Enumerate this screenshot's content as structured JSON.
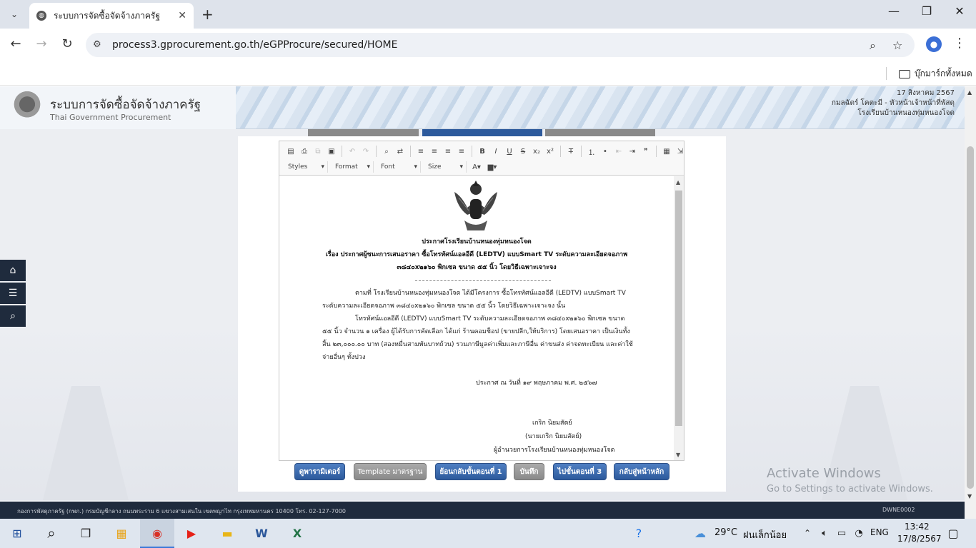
{
  "browser": {
    "tab_title": "ระบบการจัดซื้อจัดจ้างภาครัฐ",
    "url": "process3.gprocurement.go.th/eGPProcure/secured/HOME",
    "bookmarks_folder": "บุ๊กมาร์กทั้งหมด"
  },
  "header": {
    "site_name": "ระบบการจัดซื้อจัดจ้างภาครัฐ",
    "site_name_en": "Thai Government Procurement",
    "date": "17 สิงหาคม 2567",
    "user": "กมลฉัตร์ โคตะมี - หัวหน้าเจ้าหน้าที่พัสดุ",
    "org": "โรงเรียนบ้านหนองทุ่มหนองโจด"
  },
  "editor": {
    "combo_styles": "Styles",
    "combo_format": "Format",
    "combo_font": "Font",
    "combo_size": "Size"
  },
  "document": {
    "title": "ประกาศโรงเรียนบ้านหนองทุ่มหนองโจด",
    "subject1": "เรื่อง ประกาศผู้ชนะการเสนอราคา ซื้อโทรทัศน์แอลอีดี (LEDTV) แบบSmart TV ระดับความละเอียดจอภาพ",
    "subject2": "๓๘๔๐x๒๑๖๐ พิกเซล ขนาด ๕๕ นิ้ว โดยวิธีเฉพาะเจาะจง",
    "body1": "ตามที่ โรงเรียนบ้านหนองทุ่มหนองโจด ได้มีโครงการ ซื้อโทรทัศน์แอลอีดี (LEDTV) แบบSmart TV",
    "body2": "ระดับความละเอียดจอภาพ ๓๘๔๐x๒๑๖๐ พิกเซล ขนาด ๕๕ นิ้ว โดยวิธีเฉพาะเจาะจง  นั้น",
    "body3": "โทรทัศน์แอลอีดี (LEDTV) แบบSmart TV ระดับความละเอียดจอภาพ ๓๘๔๐x๒๑๖๐ พิกเซล ขนาด",
    "body4": "๕๕ นิ้ว จำนวน ๑ เครื่อง ผู้ได้รับการคัดเลือก ได้แก่ ร้านคอมช็อป (ขายปลีก,ให้บริการ) โดยเสนอราคา เป็นเงินทั้ง",
    "body5": "สิ้น ๒๓,๐๐๐.๐๐ บาท (สองหมื่นสามพันบาทถ้วน) รวมภาษีมูลค่าเพิ่มและภาษีอื่น ค่าขนส่ง ค่าจดทะเบียน และค่าใช้",
    "body6": "จ่ายอื่นๆ ทั้งปวง",
    "date_line": "ประกาศ ณ วันที่  ๑๙ พฤษภาคม พ.ศ. ๒๕๖๗",
    "signer": "เกริก นิยมสัตย์",
    "signer_full": "(นายเกริก นิยมสัตย์)",
    "position": "ผู้อำนวยการโรงเรียนบ้านหนองทุ่มหนองโจด"
  },
  "buttons": {
    "preview": "ดูพารามิเตอร์",
    "template": "Template มาตรฐาน",
    "back_step1": "ย้อนกลับขั้นตอนที่ 1",
    "save": "บันทึก",
    "next_step3": "ไปขั้นตอนที่ 3",
    "home": "กลับสู่หน้าหลัก"
  },
  "activate": {
    "line1": "Activate Windows",
    "line2": "Go to Settings to activate Windows."
  },
  "footer": {
    "address": "กองการพัสดุภาครัฐ (กพภ.) กรมบัญชีกลาง ถนนพระราม 6 แขวงสามเสนใน เขตพญาไท กรุงเทพมหานคร 10400 โทร. 02-127-7000",
    "code": "DWNE0002"
  },
  "taskbar": {
    "temperature": "29°C",
    "weather": "ฝนเล็กน้อย",
    "lang": "ENG",
    "time": "13:42",
    "date": "17/8/2567"
  },
  "colors": {
    "sidebar": "#1f2b3d",
    "button_blue": "#2d5a9c",
    "step_active": "#2d5a9c",
    "step_inactive": "#8a8a8a"
  }
}
